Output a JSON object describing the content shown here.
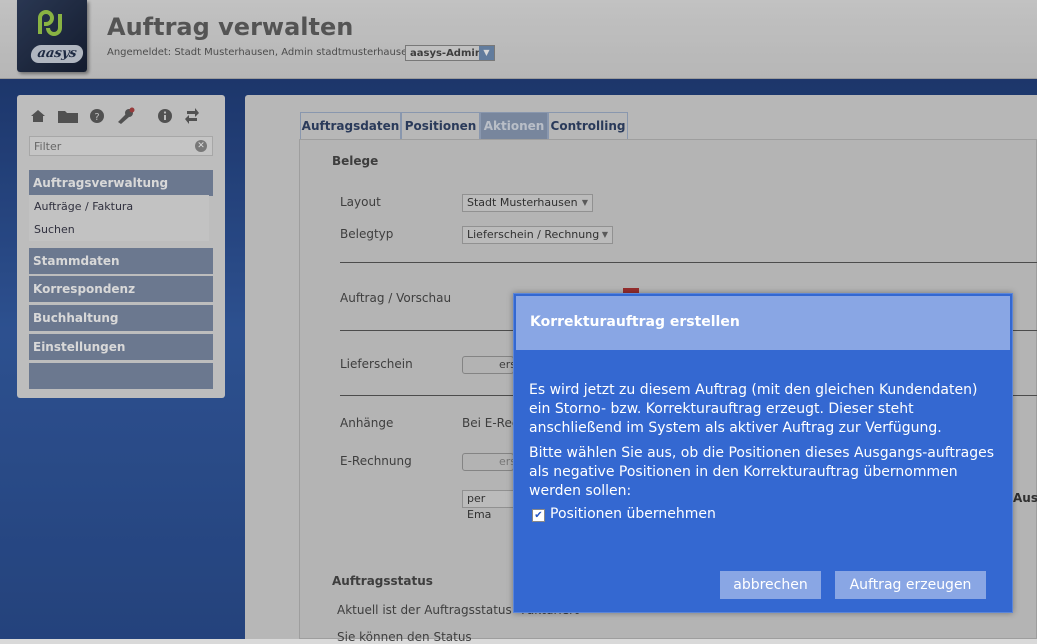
{
  "header": {
    "title": "Auftrag verwalten",
    "login": "Angemeldet: Stadt Musterhausen, Admin stadtmusterhausen",
    "role": "aasys-Admin",
    "brand": "aasys"
  },
  "sidebar": {
    "toolbar_icons": [
      "home-icon",
      "folder-icon",
      "help-icon",
      "wrench-icon",
      "info-icon",
      "refresh-icon"
    ],
    "filter_placeholder": "Filter",
    "sections": [
      {
        "label": "Auftragsverwaltung",
        "items": [
          "Aufträge / Faktura",
          "Suchen"
        ]
      },
      {
        "label": "Stammdaten"
      },
      {
        "label": "Korrespondenz"
      },
      {
        "label": "Buchhaltung"
      },
      {
        "label": "Einstellungen"
      }
    ]
  },
  "tabs": [
    "Auftragsdaten",
    "Positionen",
    "Aktionen",
    "Controlling"
  ],
  "active_tab": "Aktionen",
  "belege": {
    "title": "Belege",
    "layout_label": "Layout",
    "layout_value": "Stadt Musterhausen",
    "belegtyp_label": "Belegtyp",
    "belegtyp_value": "Lieferschein / Rechnung",
    "vorschau_label": "Auftrag / Vorschau",
    "lieferschein_label": "Lieferschein",
    "lieferschein_btn": "ers",
    "anhaenge_label": "Anhänge",
    "anhaenge_value": "Bei E-Rec",
    "erechnung_label": "E-Rechnung",
    "erechnung_btn": "ers",
    "email_select": "per Ema",
    "right_cut": "Ausga"
  },
  "status": {
    "title": "Auftragsstatus",
    "line1": "Aktuell ist der Auftragsstatus \"Fakturiert\"",
    "line2": "Sie können den Status"
  },
  "dialog": {
    "title": "Korrekturauftrag erstellen",
    "text1": "Es wird jetzt zu diesem Auftrag (mit den gleichen Kundendaten) ein Storno- bzw. Korrekturauftrag erzeugt. Dieser steht anschließend im System als aktiver Auftrag zur Verfügung.",
    "text2": "Bitte wählen Sie aus, ob die Positionen dieses Ausgangs-auftrages als negative Positionen in den Korrekturauftrag übernommen werden sollen:",
    "checkbox_label": "Positionen übernehmen",
    "checkbox_checked": true,
    "cancel": "abbrechen",
    "confirm": "Auftrag erzeugen"
  }
}
